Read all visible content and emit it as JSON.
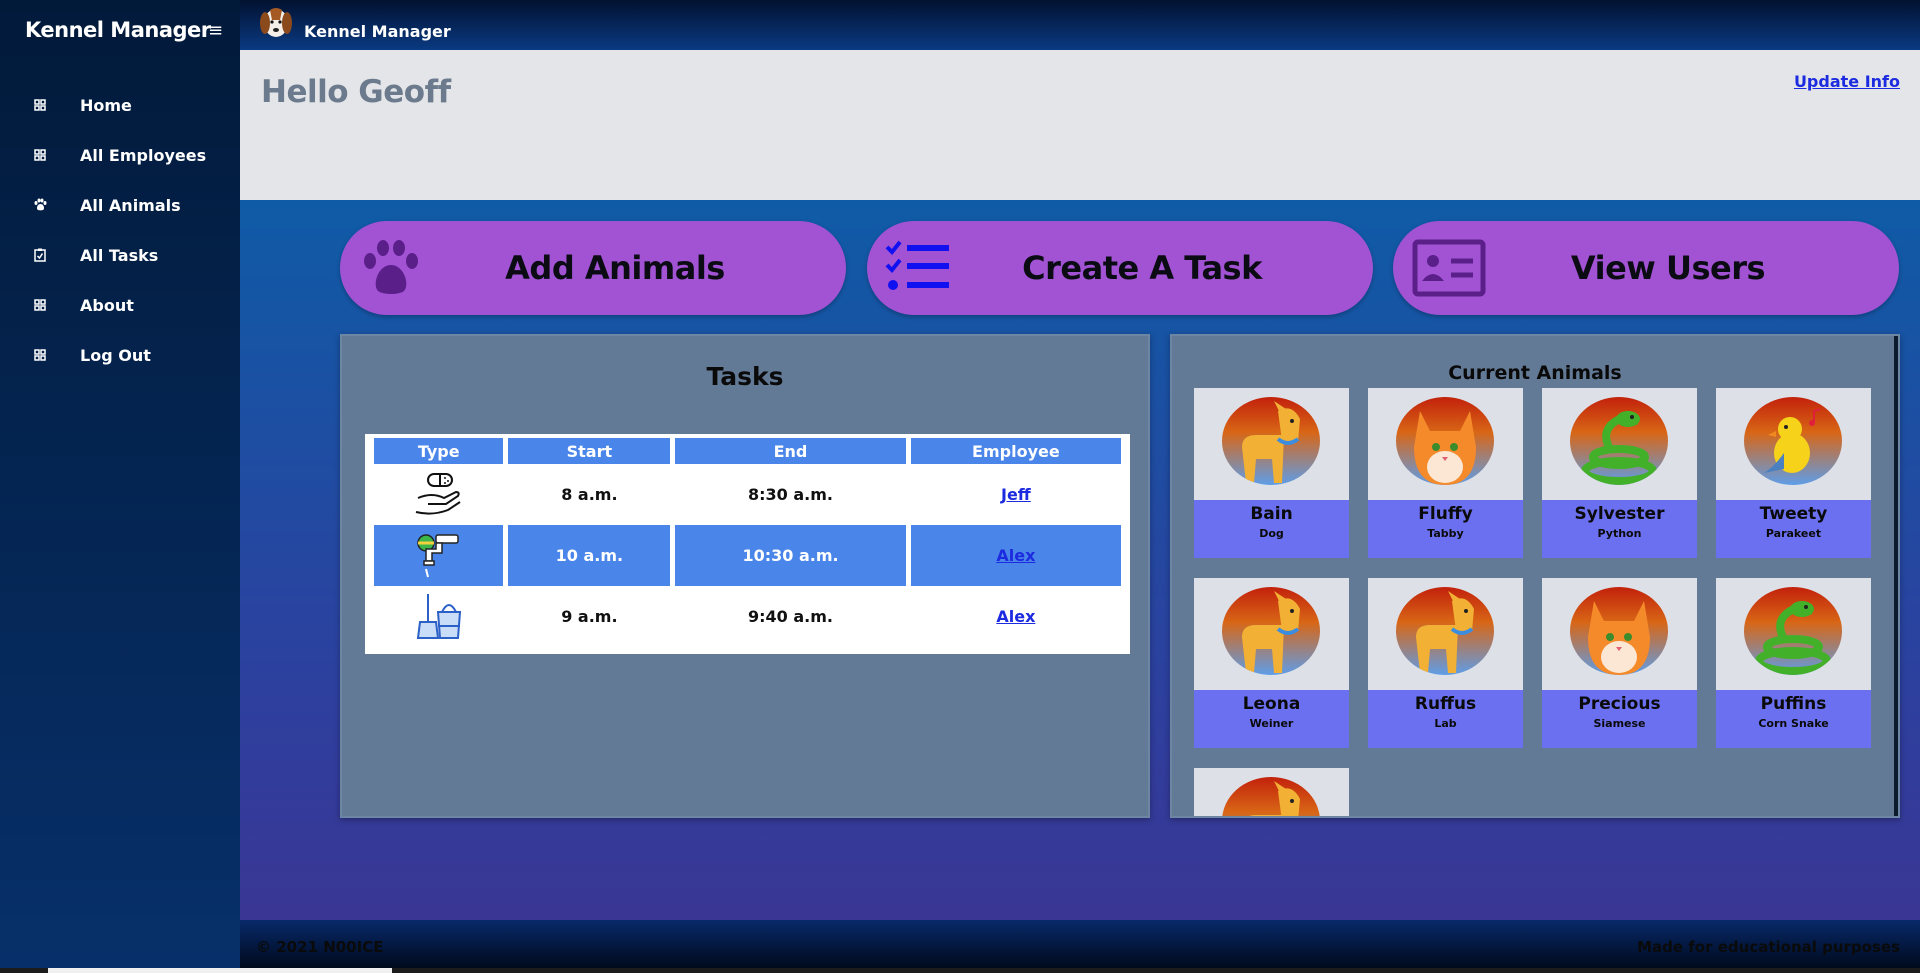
{
  "app": {
    "brand": "Kennel Manager",
    "topbar_title": "Kennel Manager"
  },
  "sidebar": {
    "items": [
      {
        "label": "Home",
        "icon": "grid-icon"
      },
      {
        "label": "All Employees",
        "icon": "grid-icon"
      },
      {
        "label": "All Animals",
        "icon": "paw-icon"
      },
      {
        "label": "All Tasks",
        "icon": "clipboard-check-icon"
      },
      {
        "label": "About",
        "icon": "grid-icon"
      },
      {
        "label": "Log Out",
        "icon": "grid-icon"
      }
    ]
  },
  "header": {
    "greeting": "Hello Geoff",
    "update_link": "Update Info"
  },
  "actions": [
    {
      "label": "Add Animals",
      "icon": "paw-icon"
    },
    {
      "label": "Create A Task",
      "icon": "checklist-icon"
    },
    {
      "label": "View Users",
      "icon": "id-card-icon"
    }
  ],
  "tasks": {
    "title": "Tasks",
    "columns": [
      "Type",
      "Start",
      "End",
      "Employee"
    ],
    "rows": [
      {
        "type_icon": "medicine-hand-icon",
        "start": "8 a.m.",
        "end": "8:30 a.m.",
        "employee": "Jeff"
      },
      {
        "type_icon": "faucet-icon",
        "start": "10 a.m.",
        "end": "10:30 a.m.",
        "employee": "Alex"
      },
      {
        "type_icon": "cleaning-bucket-icon",
        "start": "9 a.m.",
        "end": "9:40 a.m.",
        "employee": "Alex"
      }
    ]
  },
  "animals": {
    "title": "Current Animals",
    "items": [
      {
        "name": "Bain",
        "breed": "Dog",
        "icon": "dog-icon"
      },
      {
        "name": "Fluffy",
        "breed": "Tabby",
        "icon": "cat-icon"
      },
      {
        "name": "Sylvester",
        "breed": "Python",
        "icon": "snake-icon"
      },
      {
        "name": "Tweety",
        "breed": "Parakeet",
        "icon": "bird-icon"
      },
      {
        "name": "Leona",
        "breed": "Weiner",
        "icon": "dog-icon"
      },
      {
        "name": "Ruffus",
        "breed": "Lab",
        "icon": "dog-icon"
      },
      {
        "name": "Precious",
        "breed": "Siamese",
        "icon": "cat-icon"
      },
      {
        "name": "Puffins",
        "breed": "Corn Snake",
        "icon": "snake-icon"
      },
      {
        "name": "",
        "breed": "",
        "icon": "dog-icon"
      }
    ]
  },
  "footer": {
    "copyright": "© 2021 N00ICE",
    "tagline": "Made for educational purposes"
  }
}
